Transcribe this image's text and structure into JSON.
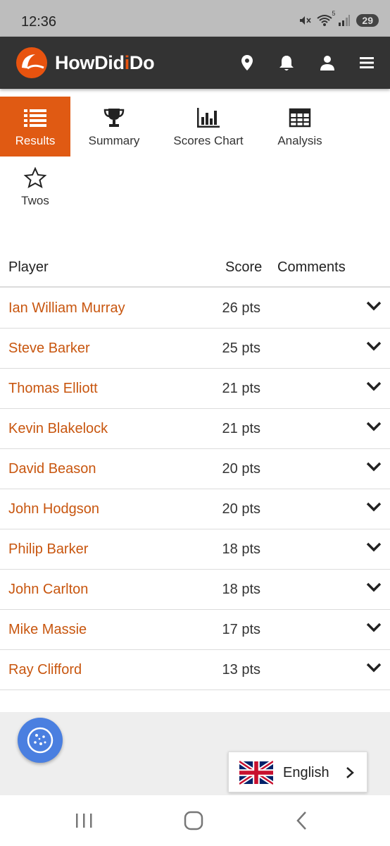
{
  "status": {
    "time": "12:36",
    "battery": "29",
    "wifi_badge": "5"
  },
  "app": {
    "brand_prefix": "HowDid",
    "brand_accent": "i",
    "brand_suffix": "Do",
    "accent_color": "#e05a13"
  },
  "appbar_icons": [
    "location-icon",
    "bell-icon",
    "user-icon",
    "menu-icon"
  ],
  "tabs": [
    {
      "label": "Results",
      "icon": "list-icon",
      "active": true
    },
    {
      "label": "Summary",
      "icon": "trophy-icon",
      "active": false
    },
    {
      "label": "Scores Chart",
      "icon": "bar-chart-icon",
      "active": false
    },
    {
      "label": "Analysis",
      "icon": "grid-icon",
      "active": false
    },
    {
      "label": "Twos",
      "icon": "star-icon",
      "active": false
    }
  ],
  "table": {
    "headers": {
      "player": "Player",
      "score": "Score",
      "comments": "Comments"
    },
    "rows": [
      {
        "player": "Ian William Murray",
        "score": "26 pts"
      },
      {
        "player": "Steve Barker",
        "score": "25 pts"
      },
      {
        "player": "Thomas Elliott",
        "score": "21 pts"
      },
      {
        "player": "Kevin Blakelock",
        "score": "21 pts"
      },
      {
        "player": "David Beason",
        "score": "20 pts"
      },
      {
        "player": "John Hodgson",
        "score": "20 pts"
      },
      {
        "player": "Philip Barker",
        "score": "18 pts"
      },
      {
        "player": "John Carlton",
        "score": "18 pts"
      },
      {
        "player": "Mike Massie",
        "score": "17 pts"
      },
      {
        "player": "Ray Clifford",
        "score": "13 pts"
      }
    ]
  },
  "language": {
    "label": "English"
  }
}
